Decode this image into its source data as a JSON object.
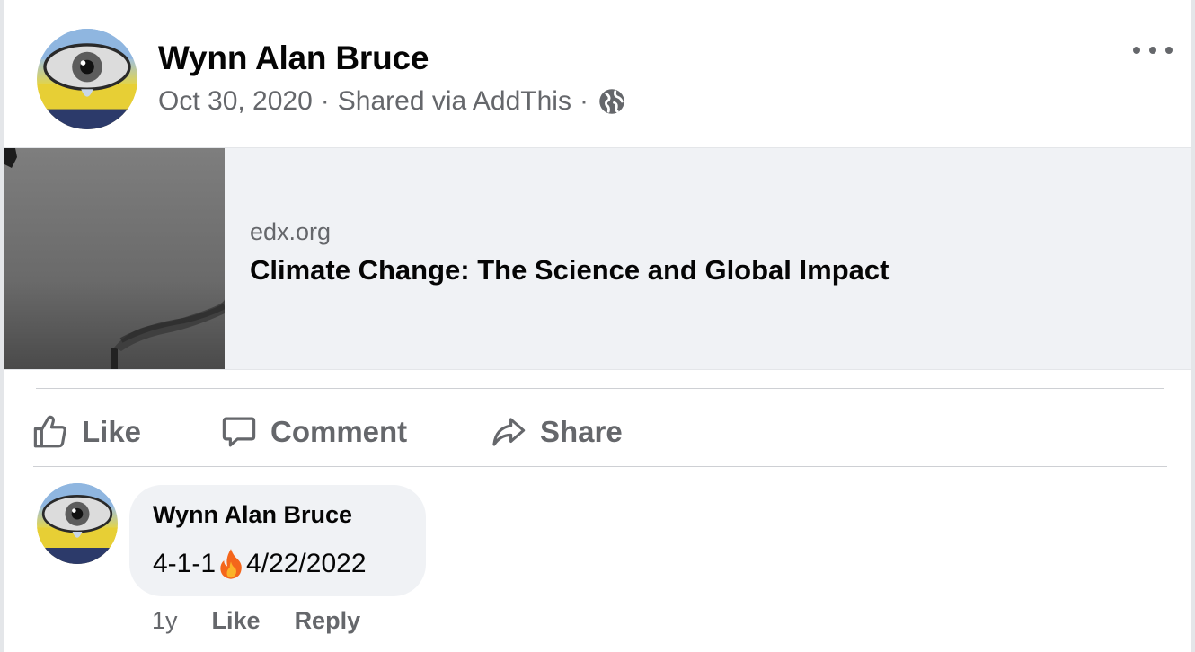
{
  "post": {
    "author": "Wynn Alan Bruce",
    "date": "Oct 30, 2020",
    "separator": "·",
    "via": "Shared via AddThis",
    "audience_icon": "globe-icon",
    "menu_icon": "more-options-icon"
  },
  "link_preview": {
    "domain": "edx.org",
    "title": "Climate Change: The Science and Global Impact"
  },
  "actions": {
    "like": "Like",
    "comment": "Comment",
    "share": "Share"
  },
  "comment": {
    "author": "Wynn Alan Bruce",
    "text_before": "4-1-1",
    "emoji_icon": "fire-icon",
    "text_after": "4/22/2022",
    "time": "1y",
    "like": "Like",
    "reply": "Reply"
  },
  "colors": {
    "primary_text": "#050505",
    "secondary_text": "#65676b",
    "bubble_bg": "#f0f2f5"
  }
}
